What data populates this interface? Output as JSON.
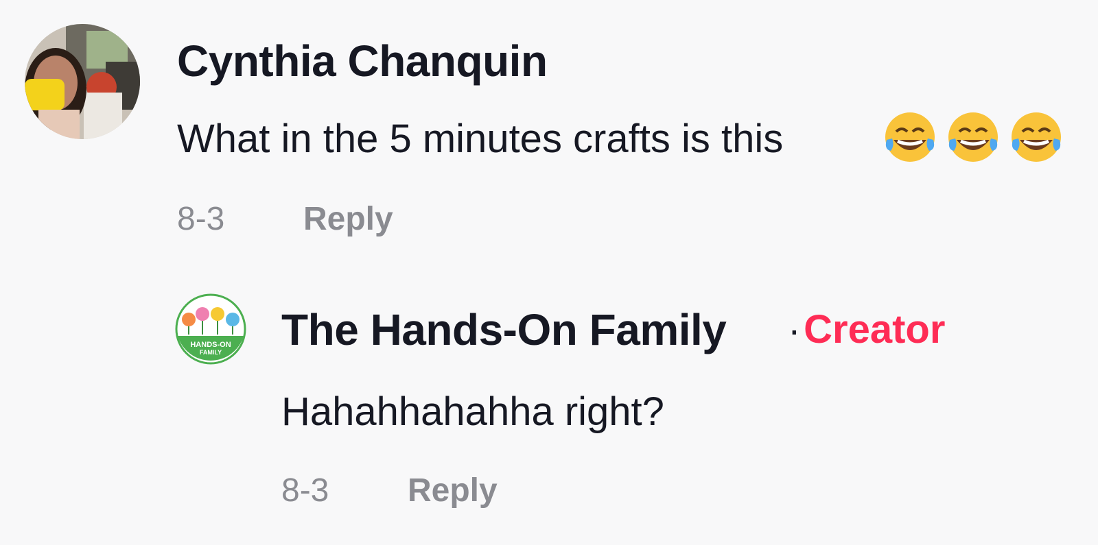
{
  "comments": [
    {
      "username": "Cynthia Chanquin",
      "text": "What in the 5 minutes crafts is this",
      "emojis": [
        "face-with-tears-of-joy",
        "face-with-tears-of-joy",
        "face-with-tears-of-joy"
      ],
      "date": "8-3",
      "reply_label": "Reply"
    },
    {
      "username": "The Hands-On Family",
      "separator": "·",
      "badge": "Creator",
      "avatar_text": [
        "HANDS-ON",
        "FAMILY"
      ],
      "text": "Hahahhahahha right?",
      "date": "8-3",
      "reply_label": "Reply"
    }
  ],
  "colors": {
    "background": "#f8f8f9",
    "text": "#161823",
    "muted": "#8a8b91",
    "creator": "#fe2c55",
    "avatar2_ring": "#4caf50"
  }
}
